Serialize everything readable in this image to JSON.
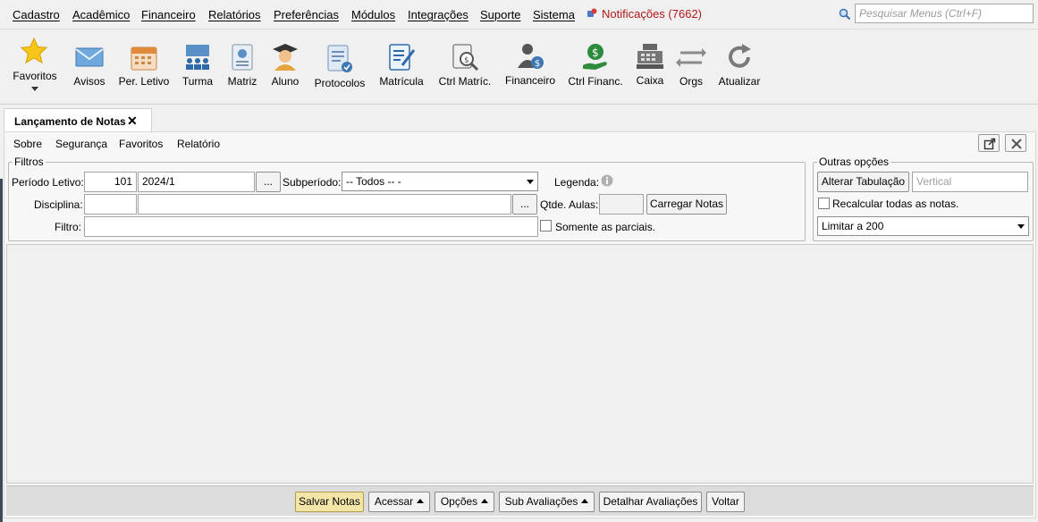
{
  "menubar": {
    "items": [
      "Cadastro",
      "Acadêmico",
      "Financeiro",
      "Relatórios",
      "Preferências",
      "Módulos",
      "Integrações",
      "Suporte",
      "Sistema"
    ],
    "notifications": "Notificações (7662)",
    "search_placeholder": "Pesquisar Menus (Ctrl+F)"
  },
  "toolbar": {
    "favoritos": "Favoritos",
    "avisos": "Avisos",
    "per_letivo": "Per. Letivo",
    "turma": "Turma",
    "matriz": "Matriz",
    "aluno": "Aluno",
    "protocolos": "Protocolos",
    "matricula": "Matrícula",
    "ctrl_matric": "Ctrl Matríc.",
    "financeiro": "Financeiro",
    "ctrl_financ": "Ctrl Financ.",
    "caixa": "Caixa",
    "orgs": "Orgs",
    "atualizar": "Atualizar"
  },
  "tab": {
    "title": "Lançamento de Notas"
  },
  "submenu": {
    "sobre": "Sobre",
    "seguranca": "Segurança",
    "favoritos": "Favoritos",
    "relatorio": "Relatório"
  },
  "filtros": {
    "legend": "Filtros",
    "periodo_label": "Período Letivo:",
    "periodo_code": "101",
    "periodo_value": "2024/1",
    "browse": "...",
    "subperiodo_label": "Subperíodo:",
    "subperiodo_value": "-- Todos -- -",
    "legenda_label": "Legenda:",
    "disciplina_label": "Disciplina:",
    "qtde_aulas_label": "Qtde. Aulas:",
    "carregar_notas": "Carregar Notas",
    "filtro_label": "Filtro:",
    "somente_parciais": "Somente as parciais."
  },
  "outras": {
    "legend": "Outras opções",
    "alterar_tabulacao": "Alterar Tabulação",
    "vertical_placeholder": "Vertical",
    "recalcular": "Recalcular todas as notas.",
    "limitar": "Limitar a 200"
  },
  "bottom": {
    "salvar": "Salvar Notas",
    "acessar": "Acessar",
    "opcoes": "Opções",
    "sub_avaliacoes": "Sub Avaliações",
    "detalhar": "Detalhar Avaliações",
    "voltar": "Voltar"
  }
}
